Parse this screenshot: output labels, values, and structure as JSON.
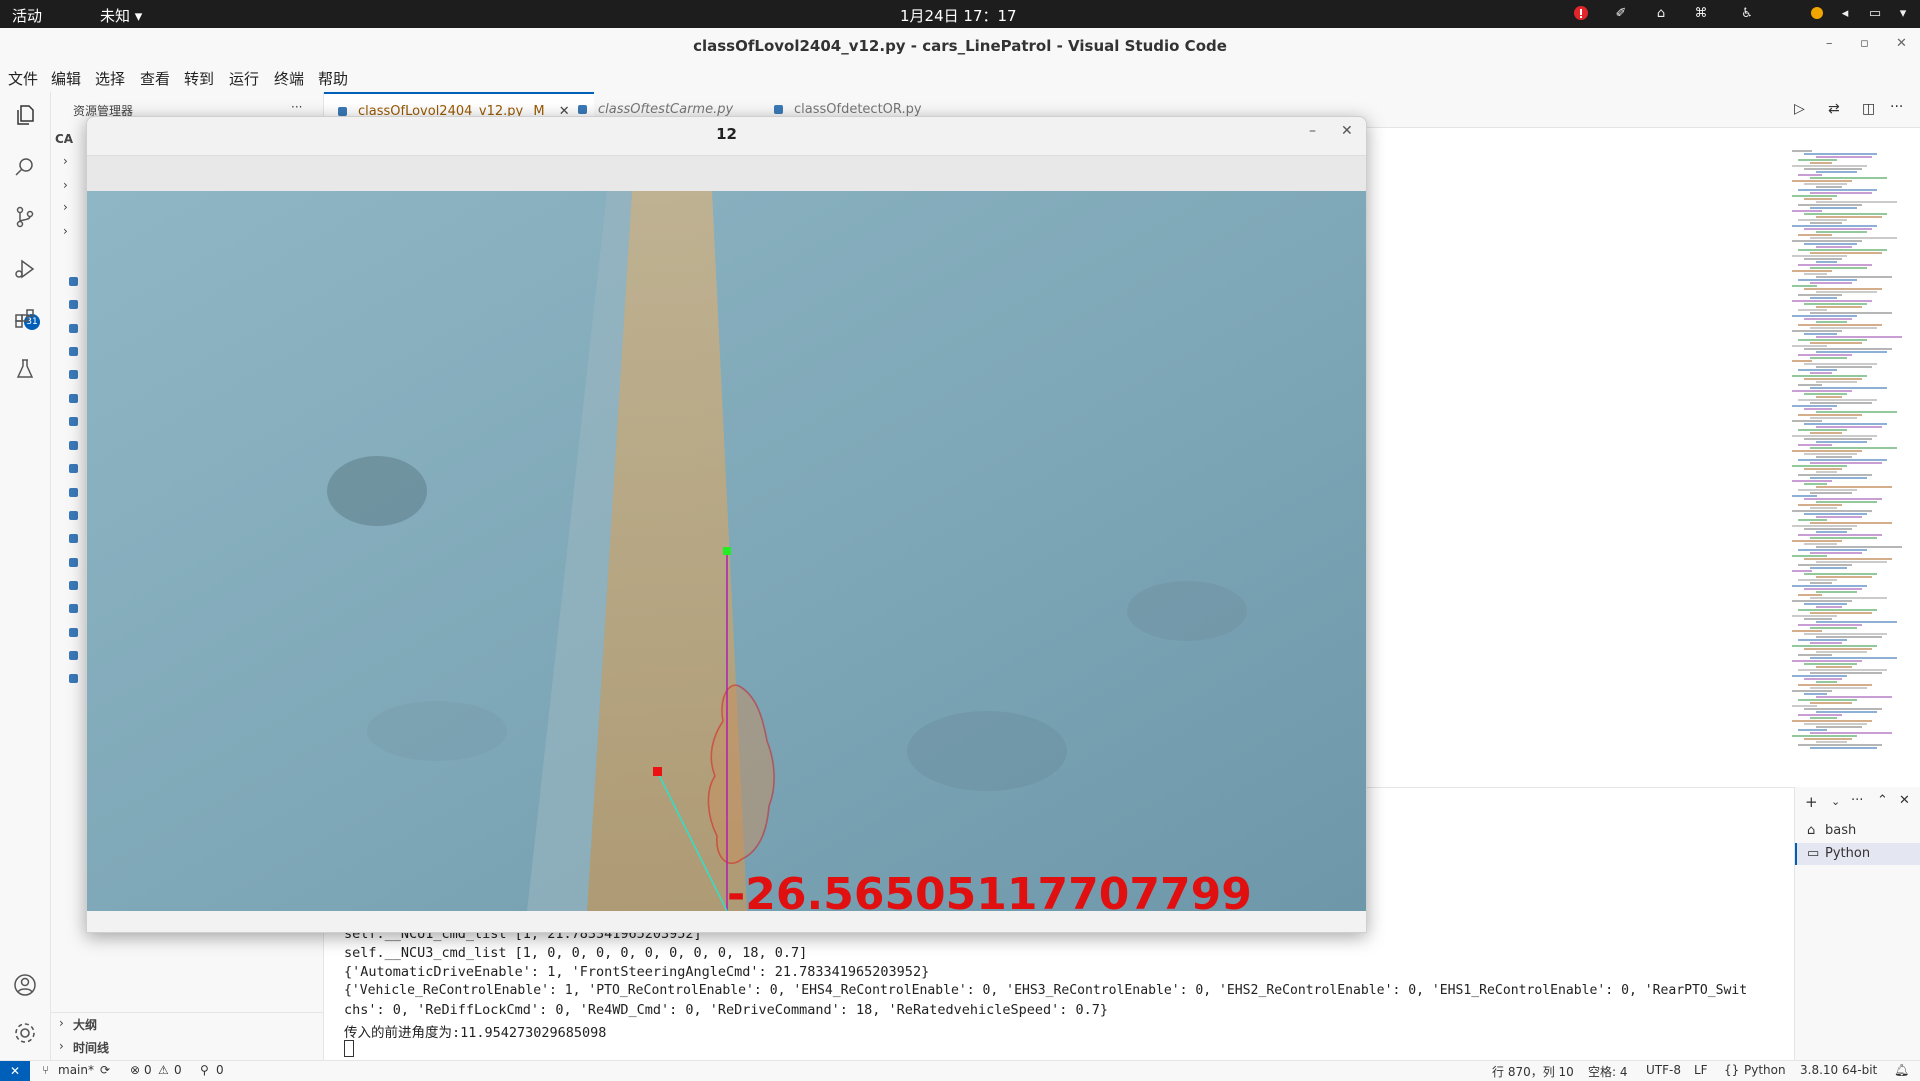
{
  "topbar": {
    "activities": "活动",
    "app_menu": "未知 ▾",
    "datetime": "1月24日  17：17"
  },
  "titlebar": {
    "title": "classOfLovol2404_v12.py - cars_LinePatrol - Visual Studio Code"
  },
  "menu": [
    "文件",
    "编辑",
    "选择",
    "查看",
    "转到",
    "运行",
    "终端",
    "帮助"
  ],
  "activity": {
    "scm_badge": "31"
  },
  "sidebar": {
    "header": "资源管理器",
    "more": "···",
    "root": "CA",
    "outline": "大纲",
    "timeline": "时间线"
  },
  "tabs": [
    {
      "label": "classOfLovol2404_v12.py",
      "modified": "M",
      "active": true
    },
    {
      "label": "classOftestCarme.py",
      "active": false
    },
    {
      "label": "classOfdetectOR.py",
      "active": false
    }
  ],
  "cv_window": {
    "title": "12",
    "overlay_text": "-26.56505117707799",
    "colors": {
      "contour": "#e01010",
      "vertical_line": "#b01fb0",
      "diagonal_line": "#2fe0c8",
      "target_point": "#22ee22",
      "center_point": "#ee1111"
    }
  },
  "terminal": {
    "lines": [
      "self.__NCU1_cmd_list [1, 21.783341965203952]",
      "self.__NCU3_cmd_list [1, 0, 0, 0, 0, 0, 0, 0, 0, 18, 0.7]",
      "{'AutomaticDriveEnable': 1, 'FrontSteeringAngleCmd': 21.783341965203952}",
      "{'Vehicle_ReControlEnable': 1, 'PTO_ReControlEnable': 0, 'EHS4_ReControlEnable': 0, 'EHS3_ReControlEnable': 0, 'EHS2_ReControlEnable': 0, 'EHS1_ReControlEnable': 0, 'RearPTO_Swit",
      "chs': 0, 'ReDiffLockCmd': 0, 'Re4WD_Cmd': 0, 'ReDriveCommand': 18, 'ReRatedvehicleSpeed': 0.7}",
      "传入的前进角度为:11.954273029685098"
    ],
    "sessions": [
      "bash",
      "Python"
    ]
  },
  "statusbar": {
    "branch": "main*",
    "errors": "0",
    "warnings": "0",
    "ports": "0",
    "position": "行 870，列 10",
    "spaces": "空格: 4",
    "encoding": "UTF-8",
    "eol": "LF",
    "language": "Python",
    "interpreter": "3.8.10 64-bit"
  }
}
